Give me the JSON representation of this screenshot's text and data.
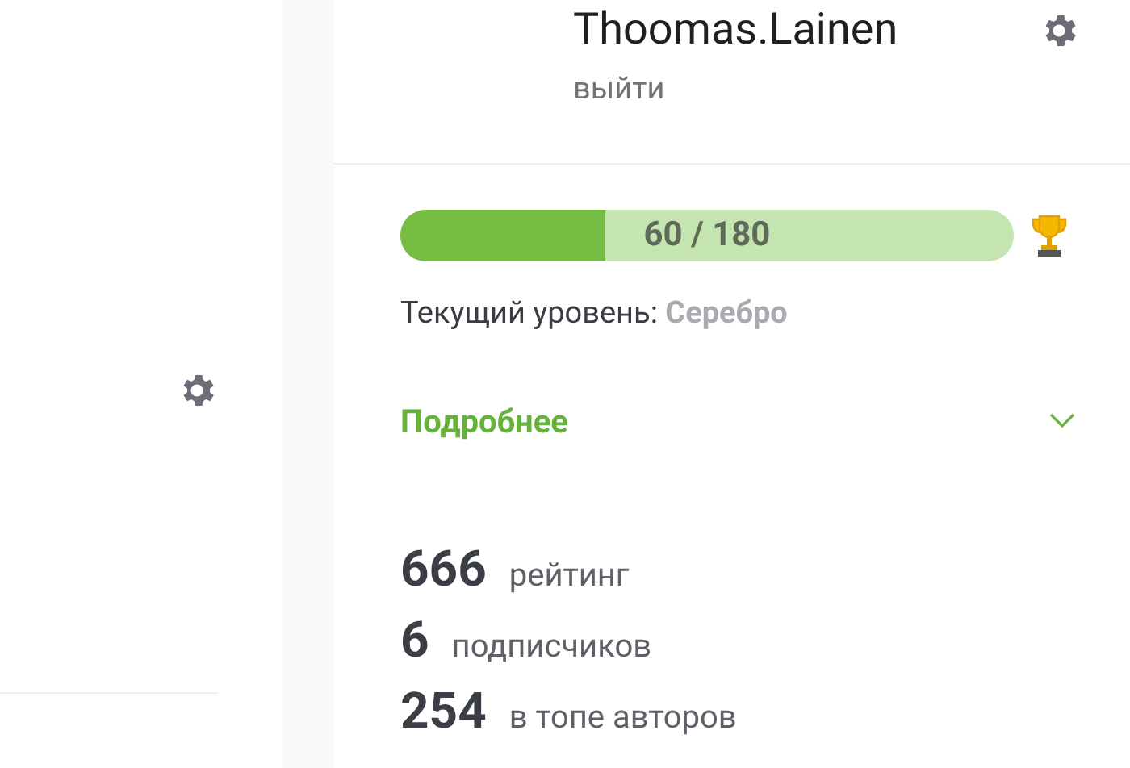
{
  "user": {
    "name": "Thoomas.Lainen",
    "logout": "выйти"
  },
  "progress": {
    "level": 0.3333,
    "reading": "60 / 180"
  },
  "current_level": {
    "label": "Текущий уровень:",
    "value": "Серебро"
  },
  "details": {
    "label": "Подробнее",
    "expanded": false
  },
  "stats": [
    {
      "number": "666",
      "label": "рейтинг"
    },
    {
      "number": "6",
      "label": "подписчиков"
    },
    {
      "number": "254",
      "label": "в топе авторов"
    }
  ]
}
